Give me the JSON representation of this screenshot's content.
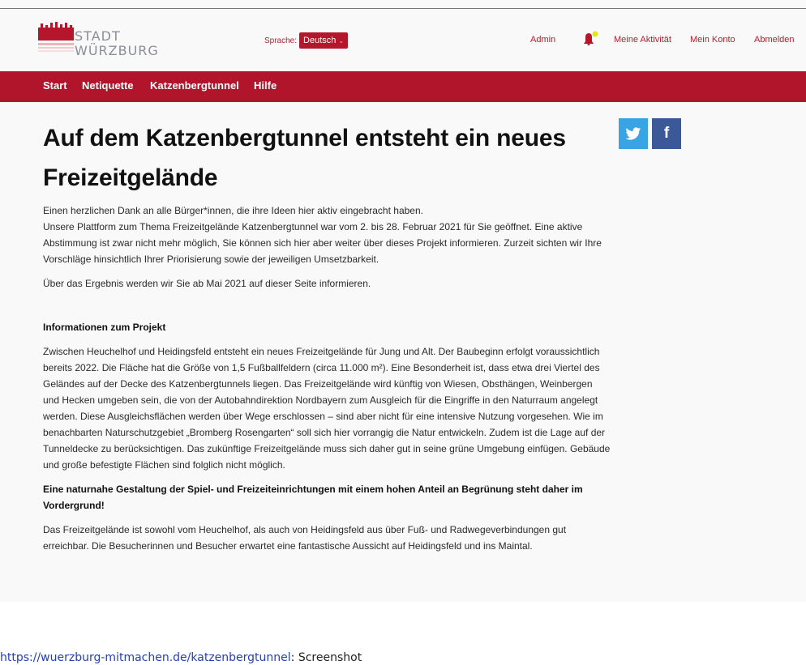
{
  "header": {
    "logo_line1": "STADT",
    "logo_line2": "WÜRZBURG",
    "language_label": "Sprache:",
    "language_value": "Deutsch",
    "nav_admin": "Admin",
    "nav_activity": "Meine Aktivität",
    "nav_account": "Mein Konto",
    "nav_logout": "Abmelden"
  },
  "main_nav": {
    "items": [
      "Start",
      "Netiquette",
      "Katzenbergtunnel",
      "Hilfe"
    ]
  },
  "share": {
    "twitter_icon": "twitter-icon",
    "facebook_icon": "facebook-icon",
    "facebook_glyph": "f"
  },
  "colors": {
    "brand_red": "#b0152b",
    "twitter_blue": "#3aa3e3",
    "facebook_blue": "#3b5998",
    "notification_dot": "#e6e41a"
  },
  "article": {
    "title": "Auf dem Katzenbergtunnel entsteht ein neues Freizeitgelände",
    "thanks": "Einen herzlichen Dank an alle Bürger*innen, die ihre Ideen hier aktiv eingebracht haben.",
    "intro": "Unsere Plattform zum Thema Freizeitgelände Katzenbergtunnel war vom 2. bis 28. Februar 2021 für Sie geöffnet. Eine aktive Abstimmung ist zwar nicht mehr möglich, Sie können sich hier aber weiter über dieses Projekt informieren. Zurzeit sichten wir Ihre Vorschläge hinsichtlich Ihrer Priorisierung sowie der jeweiligen Umsetzbarkeit.",
    "result_note": "Über das Ergebnis werden wir Sie ab Mai 2021 auf dieser Seite informieren.",
    "section_heading": "Informationen zum Projekt",
    "section_body": "Zwischen Heuchelhof und Heidingsfeld entsteht ein neues Freizeitgelände für Jung und Alt. Der Baubeginn erfolgt voraussichtlich bereits 2022. Die Fläche hat die Größe von 1,5 Fußballfeldern (circa 11.000 m²). Eine Besonderheit ist, dass etwa drei Viertel des Geländes auf der Decke des Katzenbergtunnels liegen. Das Freizeitgelände wird künftig von Wiesen, Obsthängen, Weinbergen und Hecken umgeben sein, die von der  Autobahndirektion Nordbayern zum Ausgleich für die Eingriffe in den Naturraum angelegt werden. Diese Ausgleichsflächen werden über Wege erschlossen – sind aber nicht für eine intensive Nutzung vorgesehen. Wie im benachbarten Naturschutzgebiet „Bromberg Rosengarten“ soll sich hier vorrangig die Natur entwickeln. Zudem ist die Lage auf der Tunneldecke zu berücksichtigen. Das zukünftige Freizeitgelände muss sich daher gut in seine grüne Umgebung einfügen. Gebäude und große befestigte Flächen sind folglich nicht möglich.",
    "emphasis": "Eine naturnahe Gestaltung der Spiel- und Freizeiteinrichtungen mit einem hohen Anteil an Begrünung steht daher im Vordergrund!",
    "access": "Das Freizeitgelände ist sowohl vom Heuchelhof, als auch von Heidingsfeld aus über Fuß- und Radwegeverbindungen gut erreichbar. Die Besucherinnen und Besucher erwartet eine fantastische Aussicht auf Heidingsfeld und ins Maintal."
  },
  "caption": {
    "link": "https://wuerzburg-mitmachen.de/katzenbergtunnel",
    "suffix": ": Screenshot"
  }
}
